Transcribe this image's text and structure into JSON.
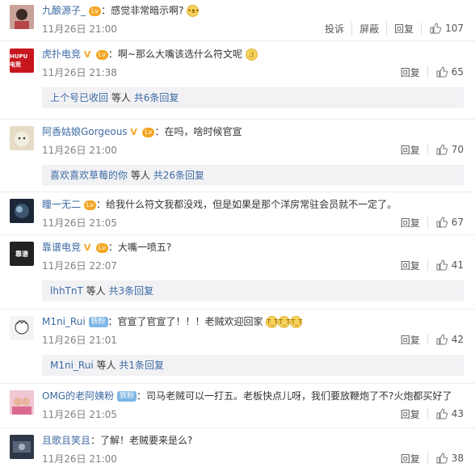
{
  "comments": [
    {
      "user": "九酿源子_",
      "text": "感觉非常暗示啊?",
      "time": "11月26日 21:00",
      "actions": [
        "投诉",
        "屏蔽",
        "回复"
      ],
      "likes": "107",
      "avatar_color": "#b5474b"
    },
    {
      "user": "虎扑电竞",
      "avatar_text": "HUPU 电竞",
      "text": "啊~那么大嘴该选什么符文呢",
      "time": "11月26日 21:38",
      "reply_label": "回复",
      "likes": "65",
      "avatar_color": "#c8161e",
      "thread": {
        "who": "上个号已收回",
        "mid": "等人",
        "more": "共6条回复"
      }
    },
    {
      "user": "阿香姑娘Gorgeous",
      "text": "在吗，啥时候官宣",
      "time": "11月26日 21:00",
      "reply_label": "回复",
      "likes": "70",
      "avatar_color": "#d9cdb3",
      "thread": {
        "who": "喜欢喜欢草莓的你",
        "mid": "等人",
        "more": "共26条回复"
      }
    },
    {
      "user": "瞳一无二",
      "text": "给我什么符文我都没戏，但是如果是那个洋房常驻会员就不一定了。",
      "time": "11月26日 21:05",
      "reply_label": "回复",
      "likes": "67",
      "avatar_color": "#1e2a3a"
    },
    {
      "user": "靠谱电竞",
      "avatar_text": "靠谱",
      "text": "大嘴一喷五?",
      "time": "11月26日 22:07",
      "reply_label": "回复",
      "likes": "41",
      "avatar_color": "#222222",
      "thread": {
        "who": "lhhTnT",
        "mid": "等人",
        "more": "共3条回复"
      }
    },
    {
      "user": "M1ni_Rui",
      "fan_badge": "铁粉",
      "text": "官宣了官宣了！！！老贼欢迎回家",
      "time": "11月26日 21:01",
      "reply_label": "回复",
      "likes": "42",
      "avatar_color": "#e8e8e8",
      "thread": {
        "who": "M1ni_Rui",
        "mid": "等人",
        "more": "共1条回复"
      }
    },
    {
      "user": "OMG的老阿姨粉",
      "fan_badge": "铁粉",
      "text": "司马老贼可以一打五。老板快点儿呀，我们要放鞭炮了不?火炮都买好了",
      "time": "11月26日 21:05",
      "reply_label": "回复",
      "likes": "43",
      "avatar_color": "#d98aa6"
    },
    {
      "user": "且歌且笑且",
      "text": "了解！老贼要来是么?",
      "time": "11月26日 21:00",
      "reply_label": "回复",
      "likes": "38",
      "avatar_color": "#3d4756"
    }
  ],
  "colors": {
    "username": "#eb7350",
    "link": "#3d6aa3",
    "thread_bg": "#f2f2f5",
    "time": "#808080"
  }
}
